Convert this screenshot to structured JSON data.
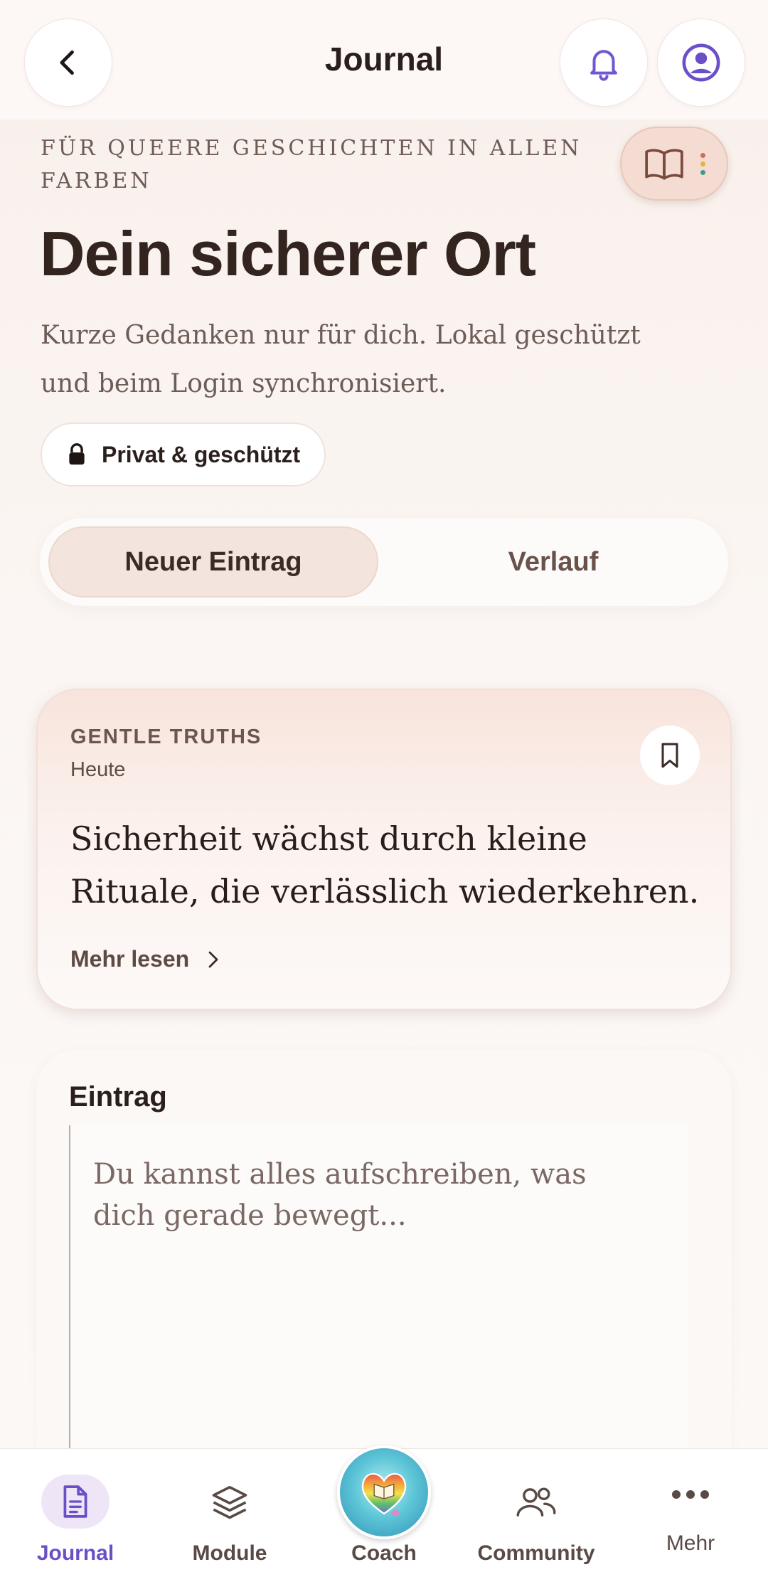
{
  "header": {
    "title": "Journal"
  },
  "hero": {
    "tagline": "Für queere Geschichten in allen Farben",
    "headline": "Dein sicherer Ort",
    "subtext": "Kurze Gedanken nur für dich. Lokal geschützt und beim Login synchronisiert.",
    "privacy_chip": "Privat & geschützt"
  },
  "tabs": [
    {
      "label": "Neuer Eintrag",
      "active": true
    },
    {
      "label": "Verlauf",
      "active": false
    }
  ],
  "truth_card": {
    "label": "GENTLE TRUTHS",
    "date": "Heute",
    "quote": "Sicherheit wächst durch kleine Rituale, die verlässlich wiederkehren.",
    "read_more": "Mehr lesen"
  },
  "entry": {
    "title": "Eintrag",
    "placeholder": "Du kannst alles aufschreiben, was dich gerade bewegt..."
  },
  "bottom_nav": [
    {
      "label": "Journal",
      "icon": "document-icon",
      "active": true
    },
    {
      "label": "Module",
      "icon": "layers-icon",
      "active": false
    },
    {
      "label": "Coach",
      "icon": "coach-avatar",
      "active": false
    },
    {
      "label": "Community",
      "icon": "people-icon",
      "active": false
    },
    {
      "label": "Mehr",
      "icon": "more-dots-icon",
      "active": false
    }
  ],
  "colors": {
    "accent_purple": "#6a4fc8",
    "text_dark": "#2a1f1c",
    "chip_rose": "#f5dcd2",
    "dot_colors": [
      "#d46a5a",
      "#e6b33d",
      "#3a9d8a"
    ]
  }
}
